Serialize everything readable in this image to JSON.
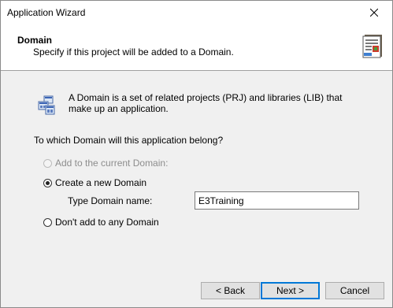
{
  "window": {
    "title": "Application Wizard",
    "close_icon": "close-icon"
  },
  "header": {
    "title": "Domain",
    "subtitle": "Specify if this project will be added to a Domain.",
    "icon": "wizard-document-icon"
  },
  "info": {
    "icon": "domain-icon",
    "text": "A Domain is a set of related projects (PRJ) and libraries (LIB) that make up an application."
  },
  "question": "To which Domain will this application belong?",
  "options": {
    "add_current": {
      "label": "Add to the current Domain:",
      "checked": false,
      "enabled": false
    },
    "create_new": {
      "label": "Create a new Domain",
      "checked": true,
      "enabled": true
    },
    "no_domain": {
      "label": "Don't add to any Domain",
      "checked": false,
      "enabled": true
    }
  },
  "domain_name": {
    "label": "Type Domain name:",
    "value": "E3Training"
  },
  "buttons": {
    "back": "< Back",
    "next": "Next >",
    "cancel": "Cancel"
  },
  "colors": {
    "default_button_border": "#0078d7",
    "header_background": "#ffffff",
    "body_background": "#f0f0f0"
  }
}
